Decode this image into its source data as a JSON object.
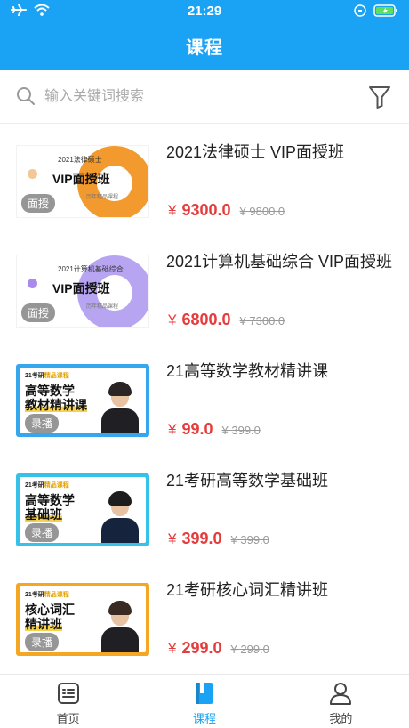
{
  "status": {
    "time": "21:29"
  },
  "header": {
    "title": "课程"
  },
  "search": {
    "placeholder": "输入关键词搜索"
  },
  "courses": [
    {
      "title": "2021法律硕士 VIP面授班",
      "currency": "¥",
      "price": "9300.0",
      "original_price": "¥ 9800.0",
      "badge": "面授",
      "thumb": {
        "style": "vip",
        "subtitle": "2021法律硕士",
        "main": "VIP面授班",
        "small": "历年精品课程",
        "accent": "#f39a2e",
        "dot": "#f4c79a"
      }
    },
    {
      "title": "2021计算机基础综合 VIP面授班",
      "currency": "¥",
      "price": "6800.0",
      "original_price": "¥ 7300.0",
      "badge": "面授",
      "thumb": {
        "style": "vip",
        "subtitle": "2021计算机基础综合",
        "main": "VIP面授班",
        "small": "历年精品课程",
        "accent": "#b7a5f2",
        "dot": "#a98bec"
      }
    },
    {
      "title": "21高等数学教材精讲课",
      "currency": "¥",
      "price": "99.0",
      "original_price": "¥ 399.0",
      "badge": "录播",
      "thumb": {
        "style": "std",
        "tag_a": "21考研",
        "tag_b": "精品课程",
        "main": "高等数学",
        "main2": "教材精讲课",
        "border": "#35a7ec",
        "hair": "#2a2424"
      }
    },
    {
      "title": "21考研高等数学基础班",
      "currency": "¥",
      "price": "399.0",
      "original_price": "¥ 399.0",
      "badge": "录播",
      "thumb": {
        "style": "std",
        "tag_a": "21考研",
        "tag_b": "精品课程",
        "main": "高等数学",
        "main2": "基础班",
        "border": "#35c1e8",
        "hair": "#1d1d1d"
      }
    },
    {
      "title": "21考研核心词汇精讲班",
      "currency": "¥",
      "price": "299.0",
      "original_price": "¥ 299.0",
      "badge": "录播",
      "thumb": {
        "style": "std",
        "tag_a": "21考研",
        "tag_b": "精品课程",
        "main": "核心词汇",
        "main2": "精讲班",
        "border": "#f5a623",
        "hair": "#3a2b22"
      }
    }
  ],
  "tabbar": {
    "items": [
      {
        "label": "首页",
        "icon": "home-list-icon",
        "active": false
      },
      {
        "label": "课程",
        "icon": "course-book-icon",
        "active": true
      },
      {
        "label": "我的",
        "icon": "profile-person-icon",
        "active": false
      }
    ]
  },
  "colors": {
    "brand": "#1aa3f5",
    "price": "#e63b3b"
  }
}
